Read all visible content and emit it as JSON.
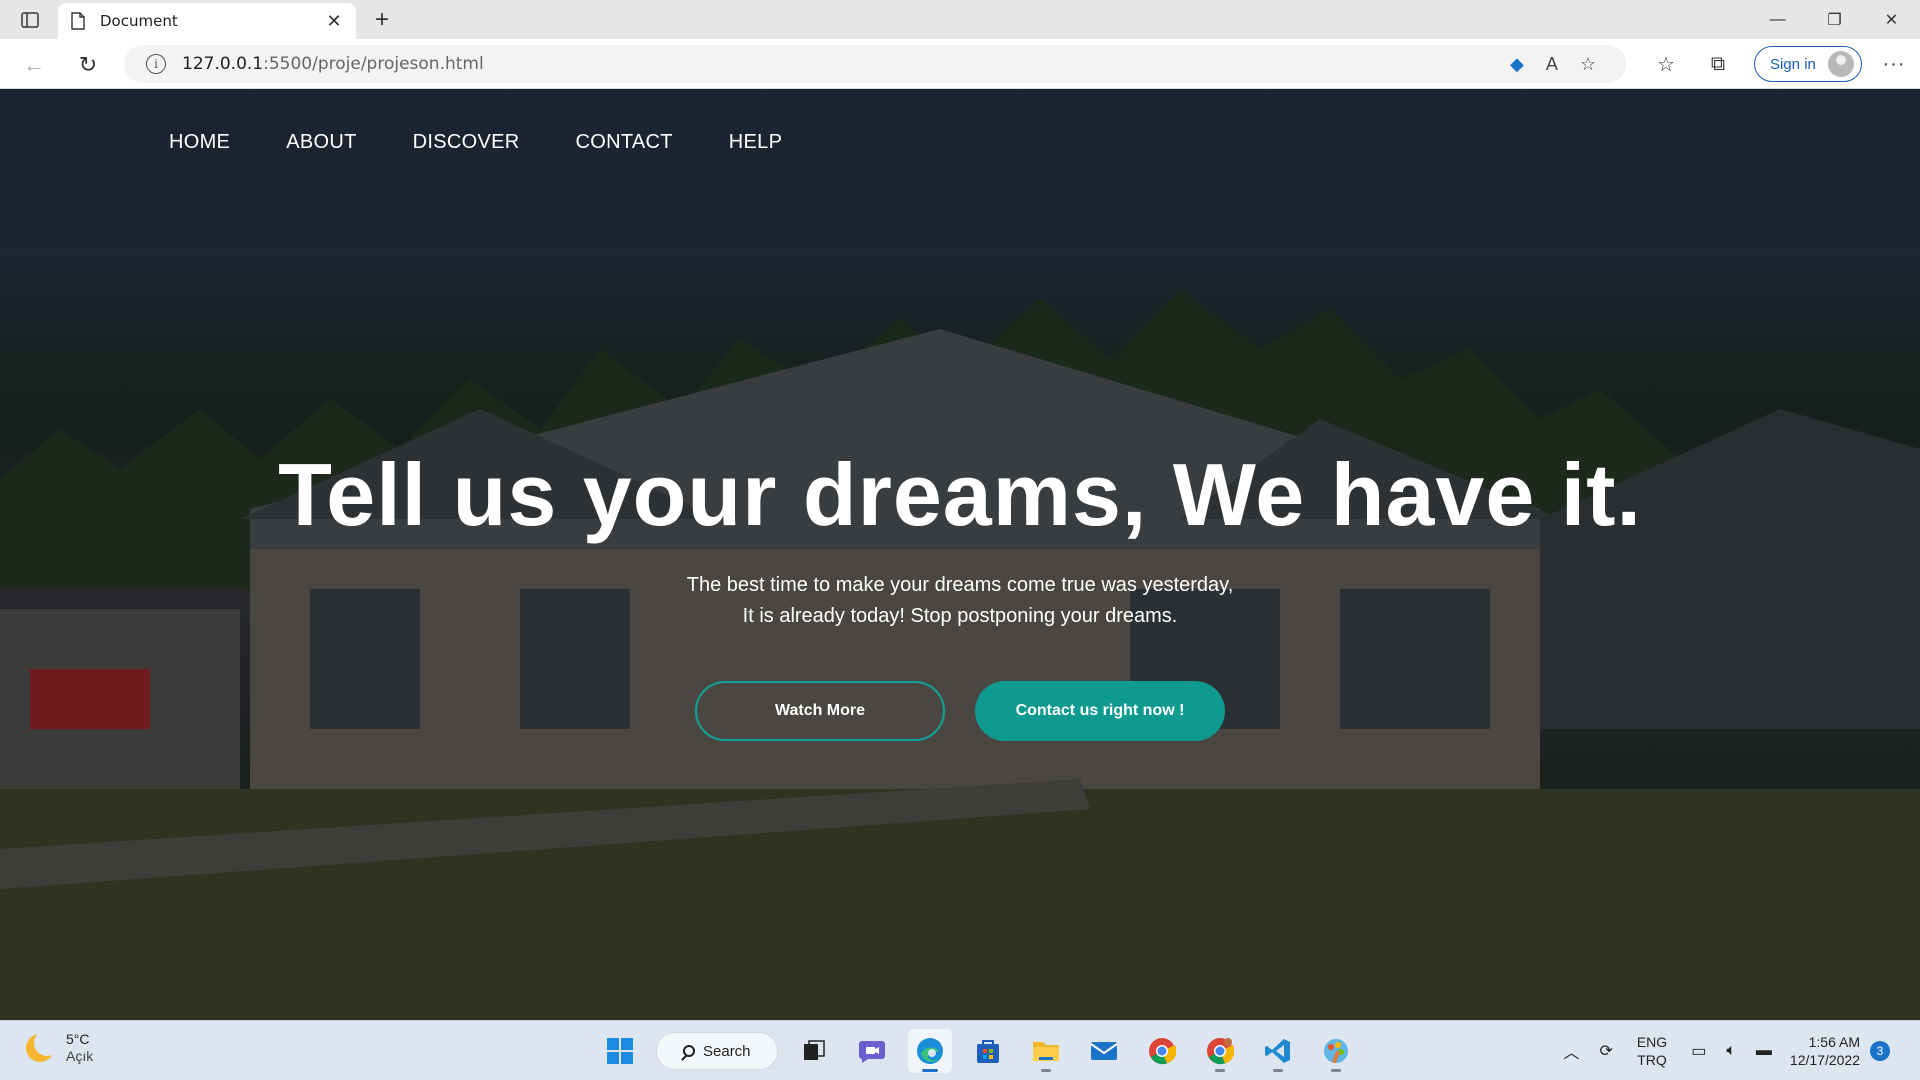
{
  "browser": {
    "tab_title": "Document",
    "url_host": "127.0.0.1",
    "url_rest": ":5500/proje/projeson.html",
    "signin_label": "Sign in"
  },
  "nav": {
    "items": [
      "HOME",
      "ABOUT",
      "DISCOVER",
      "CONTACT",
      "HELP"
    ]
  },
  "hero": {
    "title": "Tell us your dreams, We have it.",
    "line1": "The best time to make your dreams come true was yesterday,",
    "line2": "It is already today! Stop postponing your dreams.",
    "btn_watch": "Watch More",
    "btn_contact": "Contact us right now !"
  },
  "colors": {
    "accent": "#0f9a8f",
    "outline": "#10a39a"
  },
  "taskbar": {
    "weather_temp": "5°C",
    "weather_cond": "Açık",
    "search_label": "Search",
    "lang_top": "ENG",
    "lang_bottom": "TRQ",
    "time": "1:56 AM",
    "date": "12/17/2022",
    "notification_count": "3"
  }
}
